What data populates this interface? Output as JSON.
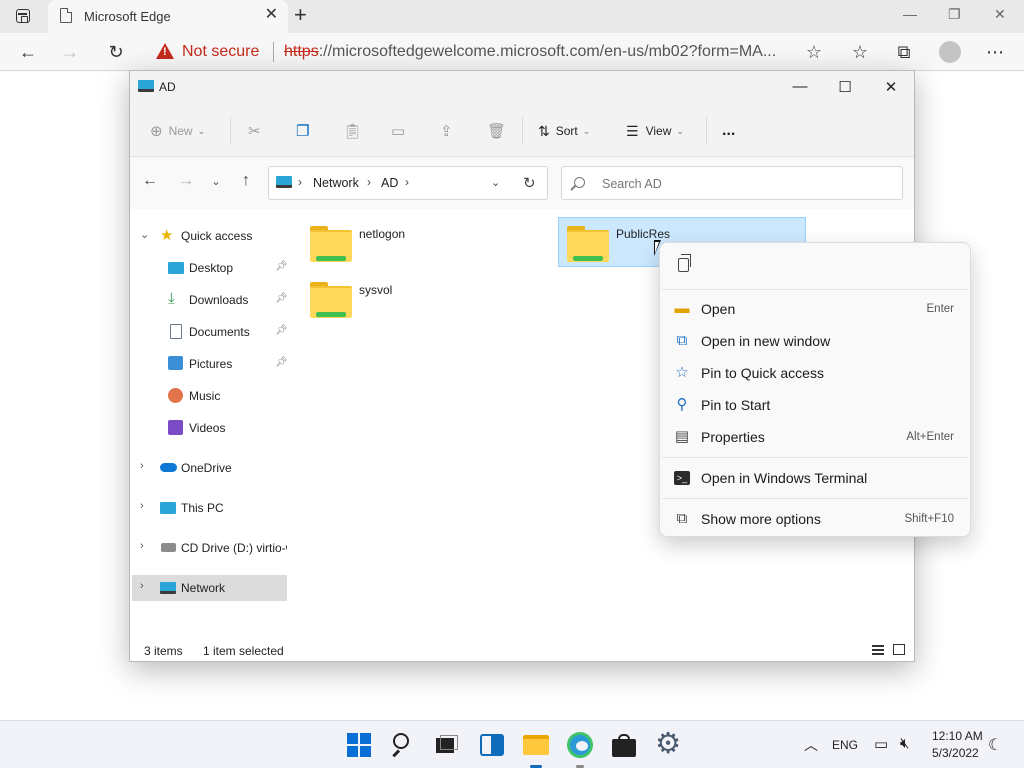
{
  "browser": {
    "tab_title": "Microsoft Edge",
    "security_label": "Not secure",
    "url_scheme": "https",
    "url_rest": "://microsoftedgewelcome.microsoft.com/en-us/mb02?form=MA..."
  },
  "explorer": {
    "window_title": "AD",
    "commands": {
      "new_label": "New",
      "sort_label": "Sort",
      "view_label": "View",
      "more_label": "..."
    },
    "breadcrumb": [
      "Network",
      "AD"
    ],
    "search_placeholder": "Search AD",
    "sidebar": {
      "quick_access": "Quick access",
      "items": [
        {
          "label": "Desktop",
          "icon": "desktop-icon",
          "pinned": true
        },
        {
          "label": "Downloads",
          "icon": "downloads-icon",
          "pinned": true
        },
        {
          "label": "Documents",
          "icon": "documents-icon",
          "pinned": true
        },
        {
          "label": "Pictures",
          "icon": "pictures-icon",
          "pinned": true
        },
        {
          "label": "Music",
          "icon": "music-icon",
          "pinned": false
        },
        {
          "label": "Videos",
          "icon": "videos-icon",
          "pinned": false
        }
      ],
      "onedrive": "OneDrive",
      "this_pc": "This PC",
      "cd_drive": "CD Drive (D:) virtio-win",
      "network": "Network"
    },
    "files": [
      {
        "name": "netlogon",
        "selected": false
      },
      {
        "name": "PublicRes",
        "selected": true
      },
      {
        "name": "sysvol",
        "selected": false
      }
    ],
    "status": {
      "item_count": "3 items",
      "selection": "1 item selected"
    }
  },
  "context_menu": {
    "items": [
      {
        "label": "Open",
        "shortcut": "Enter",
        "icon": "folder-open-icon"
      },
      {
        "label": "Open in new window",
        "shortcut": "",
        "icon": "new-window-icon"
      },
      {
        "label": "Pin to Quick access",
        "shortcut": "",
        "icon": "star-icon"
      },
      {
        "label": "Pin to Start",
        "shortcut": "",
        "icon": "pin-icon"
      },
      {
        "label": "Properties",
        "shortcut": "Alt+Enter",
        "icon": "properties-icon"
      },
      {
        "label": "Open in Windows Terminal",
        "shortcut": "",
        "icon": "terminal-icon"
      },
      {
        "label": "Show more options",
        "shortcut": "Shift+F10",
        "icon": "more-options-icon"
      }
    ]
  },
  "taskbar": {
    "language": "ENG",
    "time": "12:10 AM",
    "date": "5/3/2022"
  },
  "colors": {
    "accent": "#0067c0",
    "selection": "#cce8ff",
    "warning": "#c42b1c"
  }
}
